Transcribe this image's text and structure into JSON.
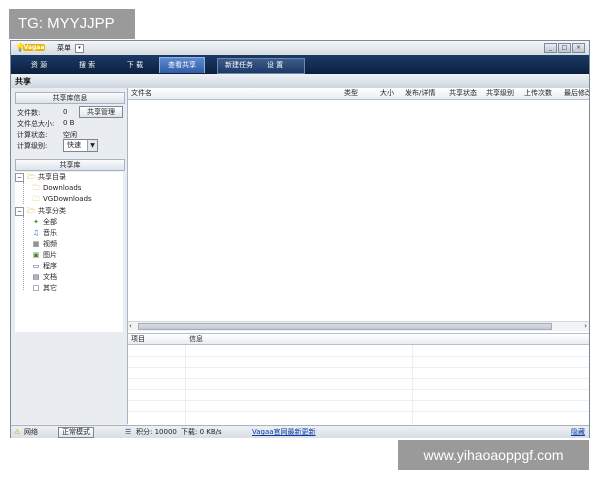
{
  "watermarks": {
    "top": "TG: MYYJJPP",
    "bottom": "www.yihaoaoppgf.com"
  },
  "titlebar": {
    "logo_text": "Vagaa",
    "menu_label": "菜单",
    "menu_arrow": "▾",
    "window_buttons": [
      "_",
      "□",
      "×"
    ]
  },
  "toolbar": {
    "tabs": [
      "资 源",
      "搜 索",
      "下 载",
      "查看共享",
      "新建任务",
      "设 置"
    ]
  },
  "section": {
    "title": "共享"
  },
  "share_info": {
    "header": "共享库信息",
    "file_count_label": "文件数:",
    "file_count_value": "0",
    "total_size_label": "文件总大小:",
    "total_size_value": "0 B",
    "calc_status_label": "计算状态:",
    "calc_status_value": "空闲",
    "calc_level_label": "计算级别:",
    "calc_level_value": "快速",
    "manage_button": "共享管理"
  },
  "library": {
    "header": "共享库",
    "dirs_title": "共享目录",
    "dirs": [
      "Downloads",
      "VGDownloads"
    ],
    "categories_title": "共享分类",
    "categories": [
      "全部",
      "音乐",
      "视频",
      "图片",
      "程序",
      "文档",
      "其它"
    ]
  },
  "file_table": {
    "columns": [
      "文件名",
      "类型",
      "大小",
      "发布/详情",
      "共享状态",
      "共享级别",
      "上传次数",
      "最后修改"
    ]
  },
  "info_table": {
    "columns": [
      "项目",
      "信息"
    ]
  },
  "scroll": {
    "left": "‹",
    "right": "›"
  },
  "statusbar": {
    "network": "网络",
    "mode_button": "正常模式",
    "score": "积分: 10000",
    "download": "下载: 0 KB/s",
    "news_link": "Vagaa官网最新更新",
    "right_link": "隐藏"
  },
  "colors": {
    "toolbar": "#0c203f",
    "active_tab": "#2f5ca3",
    "link": "#0a39a8"
  }
}
